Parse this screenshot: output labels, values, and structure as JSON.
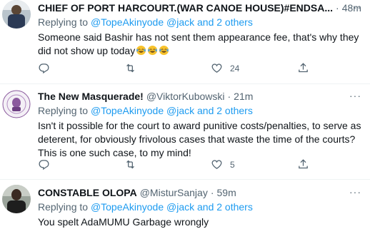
{
  "tweets": [
    {
      "name": "CHIEF OF PORT HARCOURT.(WAR CANOE HOUSE)#ENDSA...",
      "handle": "",
      "time": "48m",
      "replying_prefix": "Replying to",
      "mentions": "@TopeAkinyode @jack",
      "others": "and 2 others",
      "text": "Someone said Bashir has not sent them appearance fee, that's why they did not show up today",
      "emoji": [
        "face-with-tears-of-joy",
        "face-with-tears-of-joy",
        "face-with-tears-of-joy"
      ],
      "actions": {
        "reply_count": "",
        "retweet_count": "",
        "like_count": "24"
      }
    },
    {
      "name": "The New Masquerade!",
      "handle": "@ViktorKubowski",
      "time": "21m",
      "replying_prefix": "Replying to",
      "mentions": "@TopeAkinyode @jack",
      "others": "and 2 others",
      "text": "Isn't it possible for the court to award punitive costs/penalties, to serve as deterent, for obviously frivolous cases that waste the time of the courts? This is one such case, to my mind!",
      "actions": {
        "reply_count": "",
        "retweet_count": "",
        "like_count": "5"
      }
    },
    {
      "name": "CONSTABLE OLOPA",
      "handle": "@MisturSanjay",
      "time": "59m",
      "replying_prefix": "Replying to",
      "mentions": "@TopeAkinyode @jack",
      "others": "and 2 others",
      "text": "You spelt AdaMUMU Garbage wrongly"
    }
  ],
  "colors": {
    "accent": "#1d9bf0",
    "muted": "#536471",
    "text": "#0f1419",
    "divider": "#eff3f4"
  },
  "icons": {
    "reply": "speech-bubble-icon",
    "retweet": "retweet-icon",
    "like": "heart-icon",
    "share": "share-icon",
    "more": "more-dots-icon"
  }
}
